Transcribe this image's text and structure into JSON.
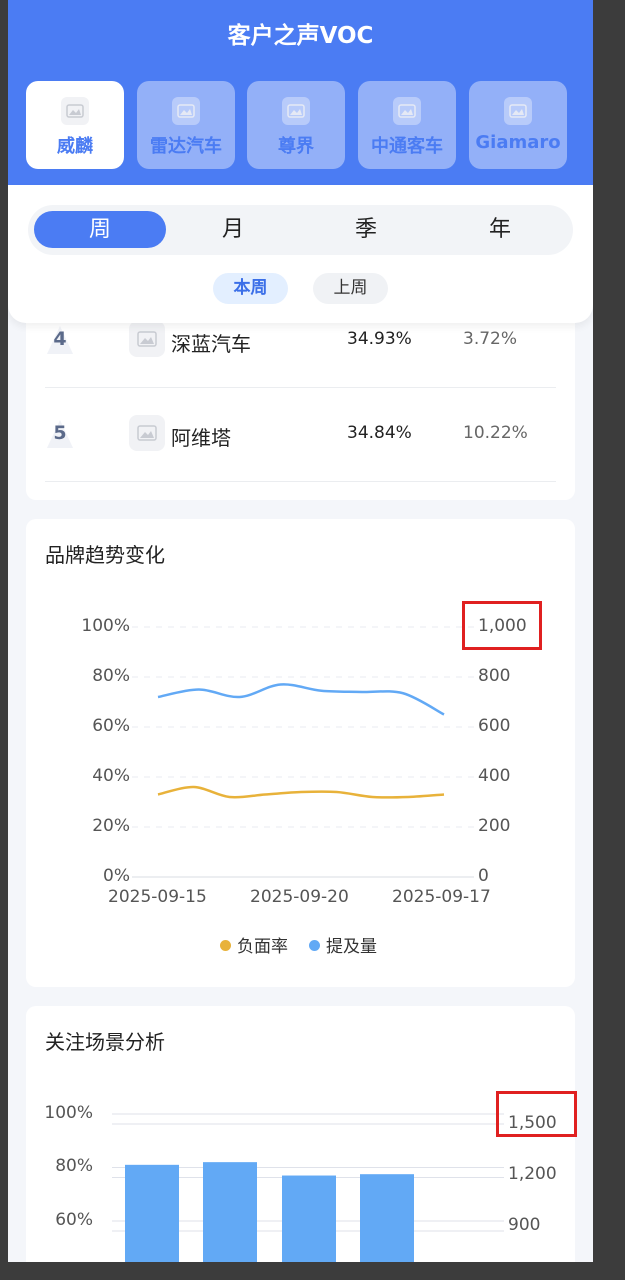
{
  "app": {
    "title": "客户之声VOC"
  },
  "brand_tabs": [
    {
      "label": "威麟",
      "active": true
    },
    {
      "label": "雷达汽车",
      "active": false
    },
    {
      "label": "尊界",
      "active": false
    },
    {
      "label": "中通客车",
      "active": false
    },
    {
      "label": "Giamaro",
      "active": false
    }
  ],
  "period_tabs": [
    {
      "label": "周",
      "active": true
    },
    {
      "label": "月",
      "active": false
    },
    {
      "label": "季",
      "active": false
    },
    {
      "label": "年",
      "active": false
    }
  ],
  "sub_periods": [
    {
      "label": "本周",
      "active": true
    },
    {
      "label": "上周",
      "active": false
    }
  ],
  "ranking": [
    {
      "rank": "4",
      "name": "深蓝汽车",
      "negative_rate": "34.93%",
      "change": "3.72%"
    },
    {
      "rank": "5",
      "name": "阿维塔",
      "negative_rate": "34.84%",
      "change": "10.22%"
    }
  ],
  "trend": {
    "title": "品牌趋势变化",
    "y_left_ticks": [
      "100%",
      "80%",
      "60%",
      "40%",
      "20%",
      "0%"
    ],
    "y_right_ticks": [
      "1,000",
      "800",
      "600",
      "400",
      "200",
      "0"
    ],
    "x_ticks": [
      "2025-09-15",
      "2025-09-20",
      "2025-09-17"
    ],
    "legend": [
      "负面率",
      "提及量"
    ]
  },
  "scene": {
    "title": "关注场景分析",
    "y_left_ticks": [
      "100%",
      "80%",
      "60%"
    ],
    "y_right_ticks": [
      "1,500",
      "1,200",
      "900"
    ]
  },
  "chart_data": [
    {
      "type": "line",
      "title": "品牌趋势变化",
      "x": [
        "2025-09-15",
        "2025-09-20",
        "2025-09-17"
      ],
      "y_left": {
        "range": [
          0,
          100
        ],
        "unit": "%"
      },
      "y_right": {
        "range": [
          0,
          1000
        ]
      },
      "grid": true,
      "legend_position": "bottom",
      "series": [
        {
          "name": "负面率",
          "axis": "left",
          "color": "#e8b23a",
          "values": [
            33,
            36,
            32,
            33,
            34,
            34,
            32,
            32,
            33
          ]
        },
        {
          "name": "提及量",
          "axis": "right",
          "color": "#62a9f5",
          "values": [
            720,
            750,
            720,
            770,
            745,
            740,
            735,
            650
          ]
        }
      ]
    },
    {
      "type": "bar",
      "title": "关注场景分析",
      "y_left": {
        "visible_range": [
          60,
          100
        ],
        "unit": "%"
      },
      "y_right": {
        "visible_range": [
          900,
          1500
        ]
      },
      "grid": true,
      "series": [
        {
          "axis": "left",
          "color": "#62a9f5",
          "values": [
            81,
            82,
            77,
            77.5
          ]
        }
      ]
    }
  ],
  "colors": {
    "primary": "#4b7cf3",
    "negative_series": "#e8b23a",
    "mention_series": "#62a9f5",
    "highlight_box": "#e02020"
  },
  "icons": {
    "brand_logo": "image-placeholder-icon",
    "rank_badge": "rank-badge-icon"
  }
}
